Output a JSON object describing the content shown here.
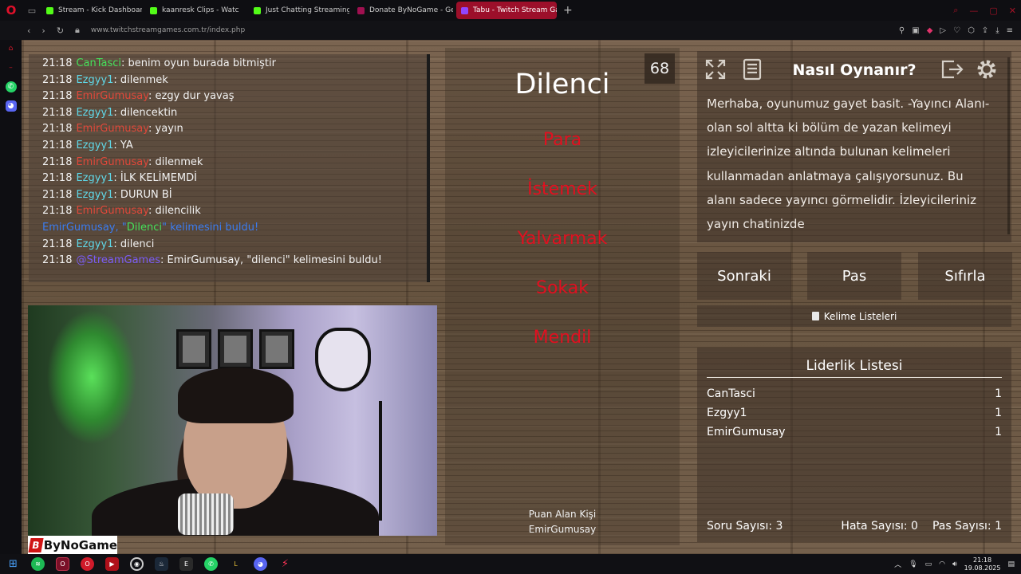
{
  "browser": {
    "tabs": [
      {
        "title": "Stream - Kick Dashboard",
        "color": "#53fc18",
        "active": false
      },
      {
        "title": "kaanresk Clips - Watc",
        "color": "#53fc18",
        "active": false
      },
      {
        "title": "Just Chatting Streaming",
        "color": "#53fc18",
        "active": false
      },
      {
        "title": "Donate ByNoGame - Gek",
        "color": "#a01050",
        "active": false
      },
      {
        "title": "Tabu - Twitch Stream Gar",
        "color": "#9146ff",
        "active": true
      }
    ],
    "url": "www.twitchstreamgames.com.tr/index.php"
  },
  "chat": {
    "lines": [
      {
        "time": "21:18",
        "user": "CanTasci",
        "user_color": "green",
        "text": ": benim oyun burada bitmiştir"
      },
      {
        "time": "21:18",
        "user": "Ezgyy1",
        "user_color": "cyan",
        "text": ": dilenmek"
      },
      {
        "time": "21:18",
        "user": "EmirGumusay",
        "user_color": "red",
        "text": ": ezgy dur yavaş"
      },
      {
        "time": "21:18",
        "user": "Ezgyy1",
        "user_color": "cyan",
        "text": ": dilencektin"
      },
      {
        "time": "21:18",
        "user": "EmirGumusay",
        "user_color": "red",
        "text": ": yayın"
      },
      {
        "time": "21:18",
        "user": "Ezgyy1",
        "user_color": "cyan",
        "text": ": YA"
      },
      {
        "time": "21:18",
        "user": "EmirGumusay",
        "user_color": "red",
        "text": ": dilenmek"
      },
      {
        "time": "21:18",
        "user": "Ezgyy1",
        "user_color": "cyan",
        "text": ": İLK KELİMEMDİ"
      },
      {
        "time": "21:18",
        "user": "Ezgyy1",
        "user_color": "cyan",
        "text": ": DURUN Bİ"
      },
      {
        "time": "21:18",
        "user": "EmirGumusay",
        "user_color": "red",
        "text": ": dilencilik"
      }
    ],
    "found_line": {
      "prefix": "EmirGumusay, \"",
      "word": "Dilenci",
      "suffix": "\" kelimesini buldu!"
    },
    "after_found": [
      {
        "time": "21:18",
        "user": "Ezgyy1",
        "user_color": "cyan",
        "text": ": dilenci"
      },
      {
        "time": "21:18",
        "user": "@StreamGames",
        "user_color": "purple",
        "text": ": EmirGumusay, \"dilenci\" kelimesini buldu!"
      }
    ]
  },
  "branding": {
    "logo_text": "ByNoGame"
  },
  "card": {
    "timer": "68",
    "word": "Dilenci",
    "taboo_words": [
      "Para",
      "İstemek",
      "Yalvarmak",
      "Sokak",
      "Mendil"
    ],
    "scorer_label": "Puan Alan Kişi",
    "scorer_name": "EmirGumusay"
  },
  "howto": {
    "title": "Nasıl Oynanır?",
    "text": "Merhaba, oyunumuz gayet basit. -Yayıncı Alanı- olan sol altta ki bölüm de yazan kelimeyi izleyicilerinize altında bulunan kelimeleri kullanmadan anlatmaya çalışıyorsunuz. Bu alanı sadece yayıncı görmelidir. İzleyicileriniz yayın chatinizde"
  },
  "buttons": {
    "next": "Sonraki",
    "pass": "Pas",
    "reset": "Sıfırla",
    "word_lists": "Kelime Listeleri"
  },
  "leaderboard": {
    "title": "Liderlik Listesi",
    "rows": [
      {
        "name": "CanTasci",
        "score": "1"
      },
      {
        "name": "Ezgyy1",
        "score": "1"
      },
      {
        "name": "EmirGumusay",
        "score": "1"
      }
    ],
    "question_count": "Soru Sayısı: 3",
    "error_count": "Hata Sayısı: 0",
    "pass_count": "Pas Sayısı: 1"
  },
  "taskbar": {
    "time": "21:18",
    "date": "19.08.2025"
  }
}
